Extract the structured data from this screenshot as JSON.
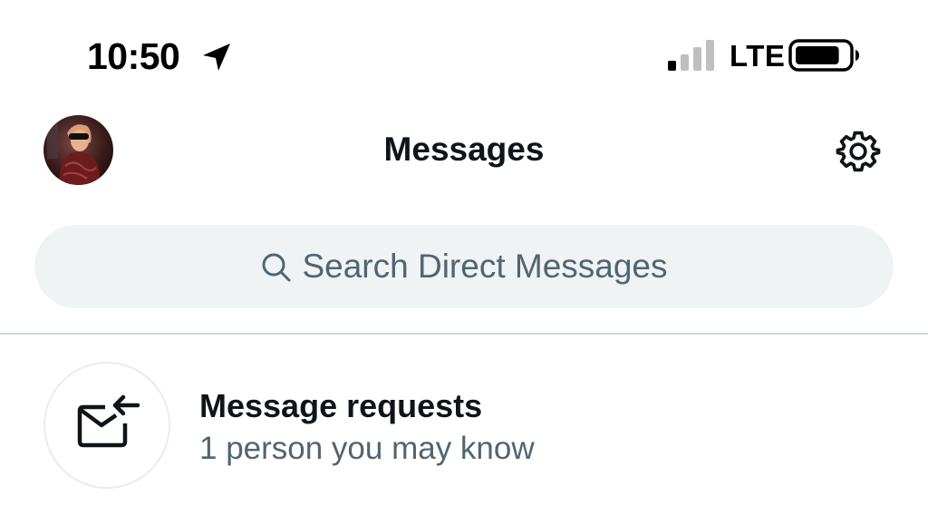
{
  "status_bar": {
    "time": "10:50",
    "network": "LTE",
    "signal_bars_active": 1,
    "signal_bars_total": 4,
    "battery_level": 0.85
  },
  "header": {
    "title": "Messages",
    "avatar_icon": "profile-avatar",
    "settings_icon": "gear-icon"
  },
  "search": {
    "placeholder": "Search Direct Messages",
    "icon": "search-icon"
  },
  "message_requests": {
    "title": "Message requests",
    "subtitle": "1 person you may know",
    "icon": "envelope-arrow-icon"
  },
  "colors": {
    "text_primary": "#0f1419",
    "text_secondary": "#536471",
    "search_background": "#eff3f4",
    "divider": "#cfd9de"
  }
}
